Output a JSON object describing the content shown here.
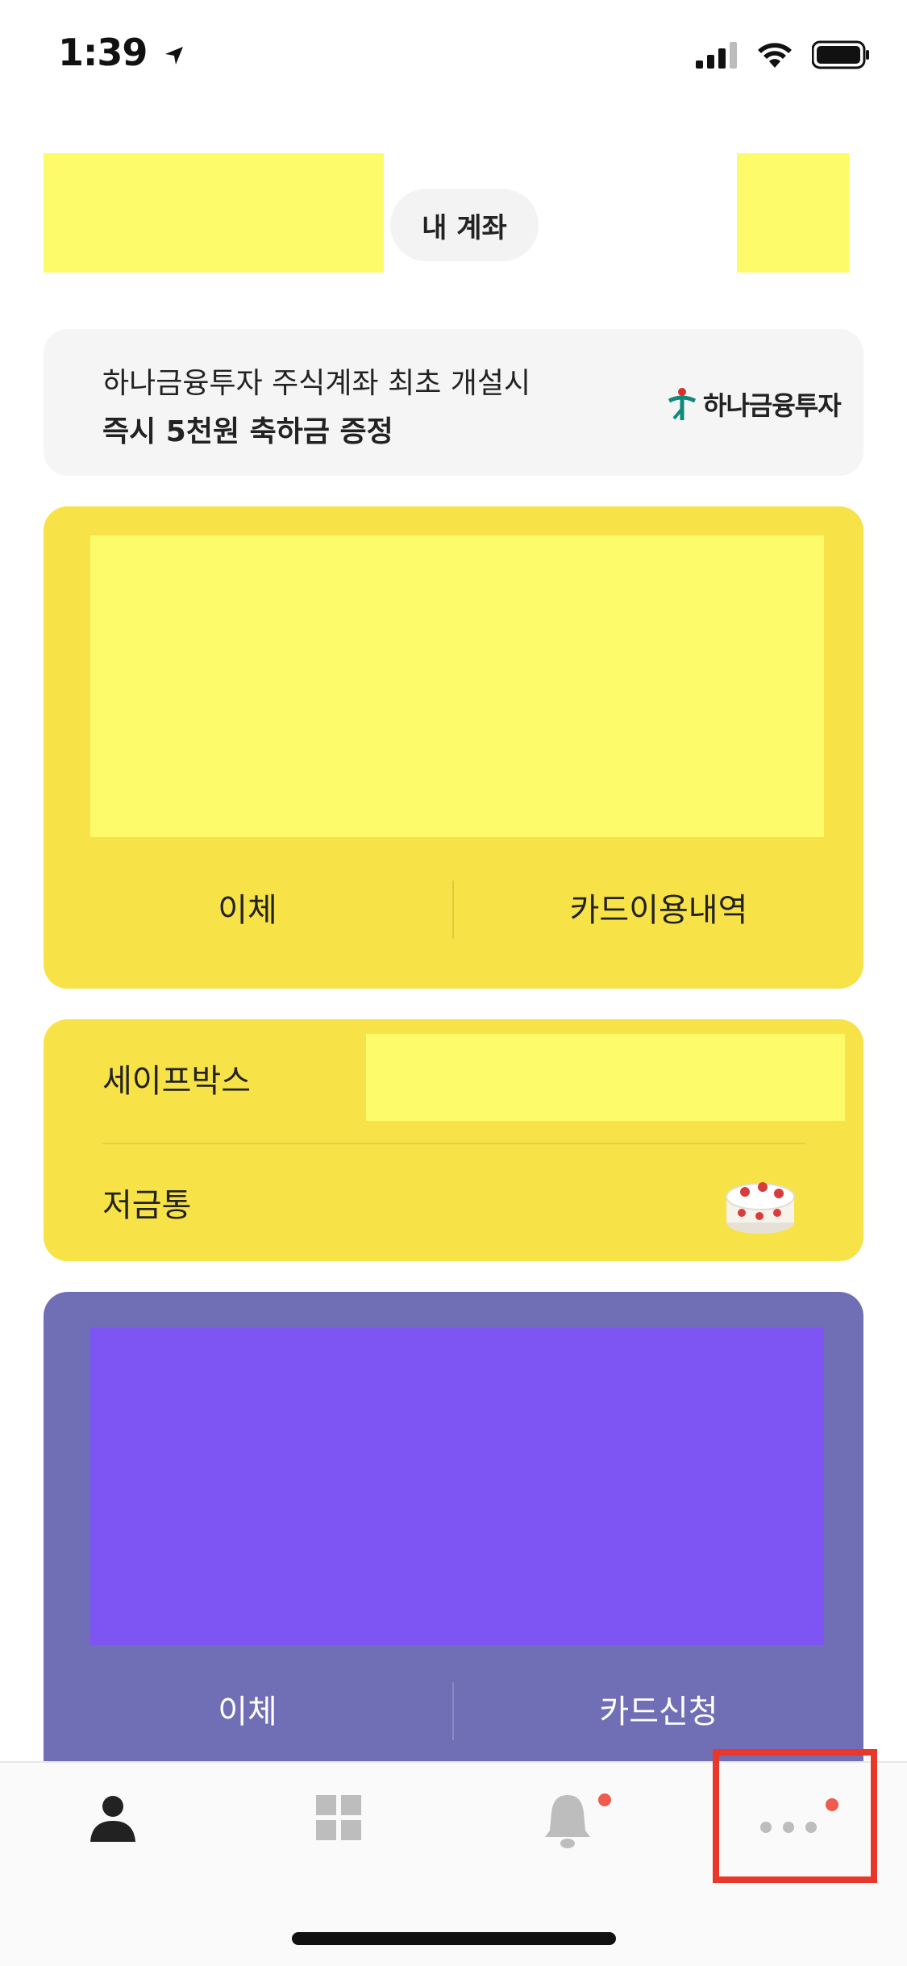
{
  "status_bar": {
    "time": "1:39"
  },
  "header": {
    "my_account_label": "내 계좌"
  },
  "banner": {
    "line1": "하나금융투자 주식계좌 최초 개설시",
    "line2": "즉시 5천원 축하금 증정",
    "brand": "하나금융투자"
  },
  "yellow_card": {
    "transfer_label": "이체",
    "card_history_label": "카드이용내역"
  },
  "safebox_card": {
    "safebox_label": "세이프박스",
    "piggybank_label": "저금통"
  },
  "purple_card": {
    "transfer_label": "이체",
    "card_apply_label": "카드신청"
  },
  "tab_bar": {
    "tabs": [
      {
        "icon": "person-icon",
        "active": true
      },
      {
        "icon": "grid-icon",
        "active": false
      },
      {
        "icon": "bell-icon",
        "active": false,
        "badge": true
      },
      {
        "icon": "more-icon",
        "active": false,
        "badge": true
      }
    ]
  },
  "colors": {
    "kakao_yellow": "#f7e247",
    "purple": "#706fb6",
    "badge_red": "#ef5b4d",
    "highlight_red": "#e8382b"
  }
}
